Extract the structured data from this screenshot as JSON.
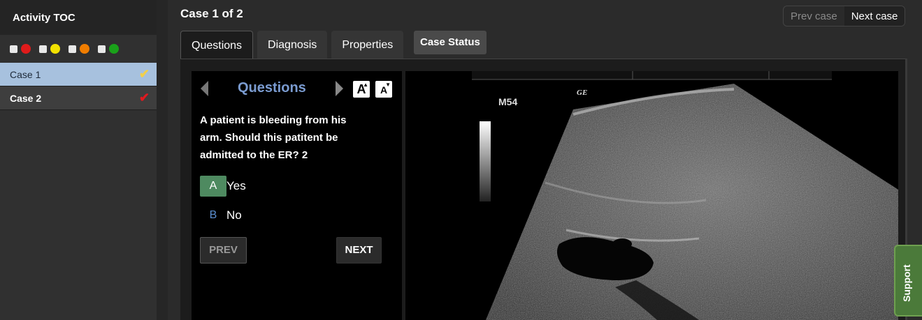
{
  "sidebar": {
    "title": "Activity TOC",
    "filters": [
      {
        "color": "#e01b1b"
      },
      {
        "color": "#f2e100"
      },
      {
        "color": "#f07d00"
      },
      {
        "color": "#1aa11a"
      }
    ],
    "cases": [
      {
        "label": "Case 1",
        "check_color": "#f2d04a"
      },
      {
        "label": "Case 2",
        "check_color": "#e0191f"
      }
    ]
  },
  "header": {
    "case_title": "Case 1 of 2",
    "prev_case": "Prev case",
    "next_case": "Next case"
  },
  "tabs": [
    {
      "label": "Questions"
    },
    {
      "label": "Diagnosis"
    },
    {
      "label": "Properties"
    }
  ],
  "case_status": "Case Status",
  "question_panel": {
    "title": "Questions",
    "font_up": "A",
    "font_down": "A",
    "question_text": "A patient is bleeding from his arm. Should this patitent be admitted to the ER? 2",
    "answers": [
      {
        "letter": "A",
        "text": "Yes"
      },
      {
        "letter": "B",
        "text": "No"
      }
    ],
    "prev_label": "PREV",
    "next_label": "NEXT"
  },
  "image_panel": {
    "overlay_label": "M54",
    "logo_text": "GE"
  },
  "support_label": "Support",
  "colors": {
    "accent_blue": "#7a9bd0",
    "answer_selected": "#4e8a60",
    "support_green": "#4b7a3a"
  }
}
